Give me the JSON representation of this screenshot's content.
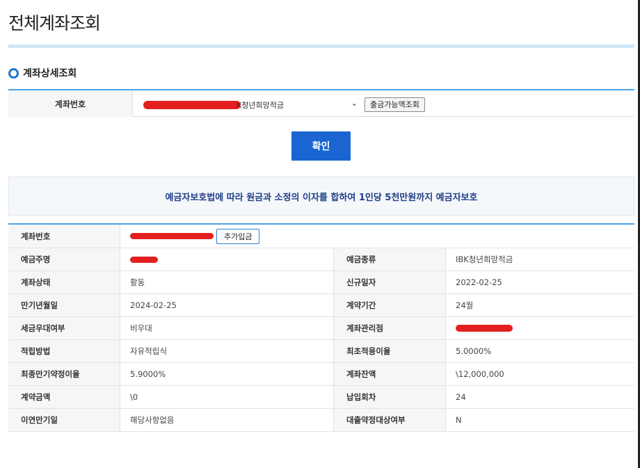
{
  "page": {
    "title": "전체계좌조회"
  },
  "section": {
    "title": "계좌상세조회"
  },
  "account_select": {
    "label": "계좌번호",
    "selected_value": "K청년희망적금",
    "balance_button": "출금가능액조회"
  },
  "confirm_button": "확인",
  "notice": "예금자보호법에 따라 원금과 소정의 이자를 합하여 1인당 5천만원까지 예금자보호",
  "detail": {
    "account_number": {
      "label": "계좌번호",
      "deposit_button": "추가입금"
    },
    "rows": [
      {
        "l_label": "예금주명",
        "l_value": "",
        "r_label": "예금종류",
        "r_value": "IBK청년희망적금"
      },
      {
        "l_label": "계좌상태",
        "l_value": "활동",
        "r_label": "신규일자",
        "r_value": "2022-02-25"
      },
      {
        "l_label": "만기년월일",
        "l_value": "2024-02-25",
        "r_label": "계약기간",
        "r_value": "24월"
      },
      {
        "l_label": "세금우대여부",
        "l_value": "비우대",
        "r_label": "계좌관리점",
        "r_value": ""
      },
      {
        "l_label": "적립방법",
        "l_value": "자유적립식",
        "r_label": "최초적용이율",
        "r_value": "5.0000%"
      },
      {
        "l_label": "최종만기약정이율",
        "l_value": "5.9000%",
        "r_label": "계좌잔액",
        "r_value": "\\12,000,000"
      },
      {
        "l_label": "계약금액",
        "l_value": "\\0",
        "r_label": "납입회차",
        "r_value": "24"
      },
      {
        "l_label": "이연만기일",
        "l_value": "해당사항없음",
        "r_label": "대출약정대상여부",
        "r_value": "N"
      }
    ]
  },
  "colors": {
    "accent_blue": "#1a65d2",
    "rule_blue": "#4ea2e6",
    "redaction": "#e41f1f"
  }
}
